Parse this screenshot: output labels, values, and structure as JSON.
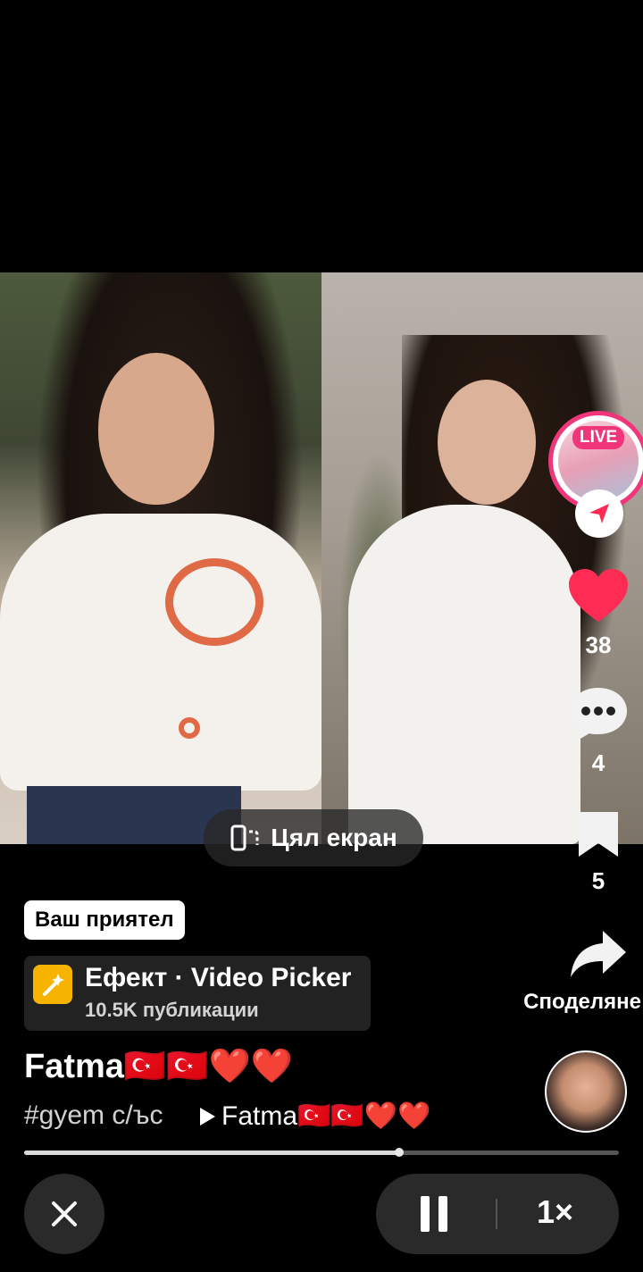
{
  "video": {
    "fullscreen_label": "Цял екран"
  },
  "rail": {
    "live_label": "LIVE",
    "likes": "38",
    "comments": "4",
    "saves": "5",
    "share_label": "Споделяне"
  },
  "post": {
    "friend_badge": "Ваш приятел",
    "effect_title": "Ефект · Video Picker",
    "effect_sub": "10.5K публикации",
    "author": "Fatma🇹🇷🇹🇷❤️❤️",
    "hashtag": "#gyem с/ъс",
    "music": "Fatma🇹🇷🇹🇷❤️❤️"
  },
  "playback": {
    "progress": 0.63,
    "speed": "1×"
  },
  "colors": {
    "like": "#fe2c55",
    "live": "#f0357b",
    "effect_icon": "#f6b300"
  }
}
